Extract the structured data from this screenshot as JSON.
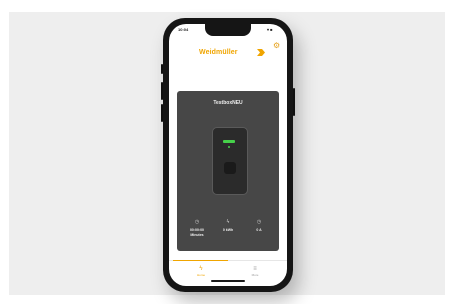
{
  "status_bar": {
    "time": "10:04",
    "indicators": "▾ ■"
  },
  "header": {
    "logo_text": "Weidmüller",
    "settings_icon": "gear-icon"
  },
  "charger": {
    "name": "TestboxNEU",
    "led_color": "#46d14a"
  },
  "stats": [
    {
      "icon": "clock-icon",
      "glyph": "◷",
      "value": "00:00:00\nMinutes"
    },
    {
      "icon": "bolt-icon",
      "glyph": "ϟ",
      "value": "0 kWh"
    },
    {
      "icon": "gauge-icon",
      "glyph": "◷",
      "value": "0 A"
    }
  ],
  "tabs": [
    {
      "label": "Home",
      "icon": "bolt-icon",
      "glyph": "ϟ",
      "active": true
    },
    {
      "label": "More",
      "icon": "menu-icon",
      "glyph": "≡",
      "active": false
    }
  ],
  "colors": {
    "accent": "#f0a500",
    "card": "#474747"
  }
}
